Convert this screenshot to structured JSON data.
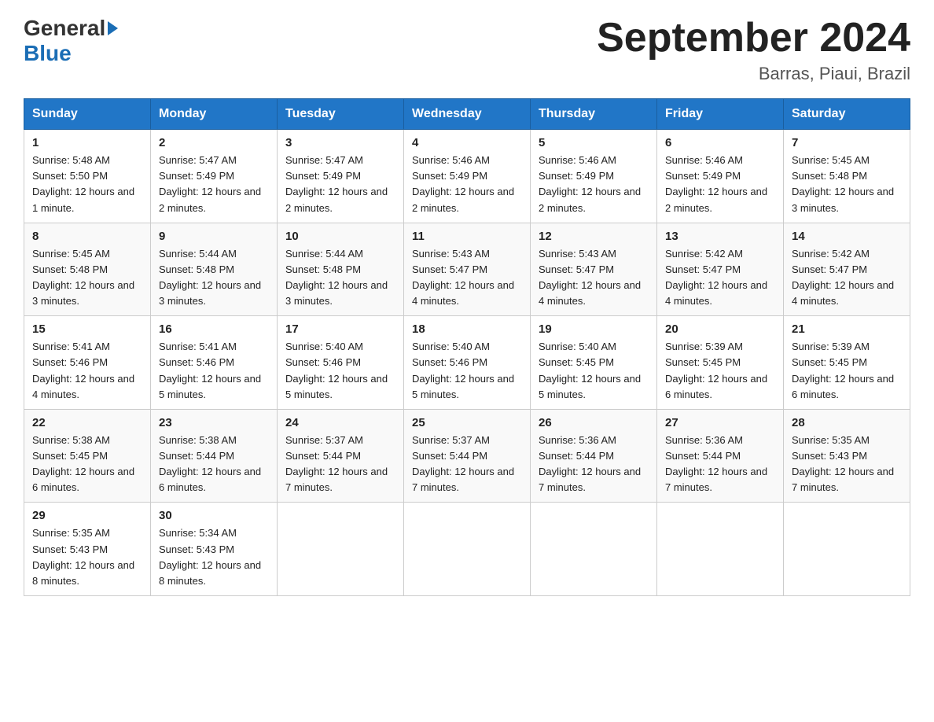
{
  "logo": {
    "text_general": "General",
    "text_blue": "Blue",
    "triangle_color": "#1a6db5"
  },
  "header": {
    "title": "September 2024",
    "subtitle": "Barras, Piaui, Brazil"
  },
  "columns": [
    "Sunday",
    "Monday",
    "Tuesday",
    "Wednesday",
    "Thursday",
    "Friday",
    "Saturday"
  ],
  "weeks": [
    [
      {
        "day": "1",
        "sunrise": "Sunrise: 5:48 AM",
        "sunset": "Sunset: 5:50 PM",
        "daylight": "Daylight: 12 hours and 1 minute."
      },
      {
        "day": "2",
        "sunrise": "Sunrise: 5:47 AM",
        "sunset": "Sunset: 5:49 PM",
        "daylight": "Daylight: 12 hours and 2 minutes."
      },
      {
        "day": "3",
        "sunrise": "Sunrise: 5:47 AM",
        "sunset": "Sunset: 5:49 PM",
        "daylight": "Daylight: 12 hours and 2 minutes."
      },
      {
        "day": "4",
        "sunrise": "Sunrise: 5:46 AM",
        "sunset": "Sunset: 5:49 PM",
        "daylight": "Daylight: 12 hours and 2 minutes."
      },
      {
        "day": "5",
        "sunrise": "Sunrise: 5:46 AM",
        "sunset": "Sunset: 5:49 PM",
        "daylight": "Daylight: 12 hours and 2 minutes."
      },
      {
        "day": "6",
        "sunrise": "Sunrise: 5:46 AM",
        "sunset": "Sunset: 5:49 PM",
        "daylight": "Daylight: 12 hours and 2 minutes."
      },
      {
        "day": "7",
        "sunrise": "Sunrise: 5:45 AM",
        "sunset": "Sunset: 5:48 PM",
        "daylight": "Daylight: 12 hours and 3 minutes."
      }
    ],
    [
      {
        "day": "8",
        "sunrise": "Sunrise: 5:45 AM",
        "sunset": "Sunset: 5:48 PM",
        "daylight": "Daylight: 12 hours and 3 minutes."
      },
      {
        "day": "9",
        "sunrise": "Sunrise: 5:44 AM",
        "sunset": "Sunset: 5:48 PM",
        "daylight": "Daylight: 12 hours and 3 minutes."
      },
      {
        "day": "10",
        "sunrise": "Sunrise: 5:44 AM",
        "sunset": "Sunset: 5:48 PM",
        "daylight": "Daylight: 12 hours and 3 minutes."
      },
      {
        "day": "11",
        "sunrise": "Sunrise: 5:43 AM",
        "sunset": "Sunset: 5:47 PM",
        "daylight": "Daylight: 12 hours and 4 minutes."
      },
      {
        "day": "12",
        "sunrise": "Sunrise: 5:43 AM",
        "sunset": "Sunset: 5:47 PM",
        "daylight": "Daylight: 12 hours and 4 minutes."
      },
      {
        "day": "13",
        "sunrise": "Sunrise: 5:42 AM",
        "sunset": "Sunset: 5:47 PM",
        "daylight": "Daylight: 12 hours and 4 minutes."
      },
      {
        "day": "14",
        "sunrise": "Sunrise: 5:42 AM",
        "sunset": "Sunset: 5:47 PM",
        "daylight": "Daylight: 12 hours and 4 minutes."
      }
    ],
    [
      {
        "day": "15",
        "sunrise": "Sunrise: 5:41 AM",
        "sunset": "Sunset: 5:46 PM",
        "daylight": "Daylight: 12 hours and 4 minutes."
      },
      {
        "day": "16",
        "sunrise": "Sunrise: 5:41 AM",
        "sunset": "Sunset: 5:46 PM",
        "daylight": "Daylight: 12 hours and 5 minutes."
      },
      {
        "day": "17",
        "sunrise": "Sunrise: 5:40 AM",
        "sunset": "Sunset: 5:46 PM",
        "daylight": "Daylight: 12 hours and 5 minutes."
      },
      {
        "day": "18",
        "sunrise": "Sunrise: 5:40 AM",
        "sunset": "Sunset: 5:46 PM",
        "daylight": "Daylight: 12 hours and 5 minutes."
      },
      {
        "day": "19",
        "sunrise": "Sunrise: 5:40 AM",
        "sunset": "Sunset: 5:45 PM",
        "daylight": "Daylight: 12 hours and 5 minutes."
      },
      {
        "day": "20",
        "sunrise": "Sunrise: 5:39 AM",
        "sunset": "Sunset: 5:45 PM",
        "daylight": "Daylight: 12 hours and 6 minutes."
      },
      {
        "day": "21",
        "sunrise": "Sunrise: 5:39 AM",
        "sunset": "Sunset: 5:45 PM",
        "daylight": "Daylight: 12 hours and 6 minutes."
      }
    ],
    [
      {
        "day": "22",
        "sunrise": "Sunrise: 5:38 AM",
        "sunset": "Sunset: 5:45 PM",
        "daylight": "Daylight: 12 hours and 6 minutes."
      },
      {
        "day": "23",
        "sunrise": "Sunrise: 5:38 AM",
        "sunset": "Sunset: 5:44 PM",
        "daylight": "Daylight: 12 hours and 6 minutes."
      },
      {
        "day": "24",
        "sunrise": "Sunrise: 5:37 AM",
        "sunset": "Sunset: 5:44 PM",
        "daylight": "Daylight: 12 hours and 7 minutes."
      },
      {
        "day": "25",
        "sunrise": "Sunrise: 5:37 AM",
        "sunset": "Sunset: 5:44 PM",
        "daylight": "Daylight: 12 hours and 7 minutes."
      },
      {
        "day": "26",
        "sunrise": "Sunrise: 5:36 AM",
        "sunset": "Sunset: 5:44 PM",
        "daylight": "Daylight: 12 hours and 7 minutes."
      },
      {
        "day": "27",
        "sunrise": "Sunrise: 5:36 AM",
        "sunset": "Sunset: 5:44 PM",
        "daylight": "Daylight: 12 hours and 7 minutes."
      },
      {
        "day": "28",
        "sunrise": "Sunrise: 5:35 AM",
        "sunset": "Sunset: 5:43 PM",
        "daylight": "Daylight: 12 hours and 7 minutes."
      }
    ],
    [
      {
        "day": "29",
        "sunrise": "Sunrise: 5:35 AM",
        "sunset": "Sunset: 5:43 PM",
        "daylight": "Daylight: 12 hours and 8 minutes."
      },
      {
        "day": "30",
        "sunrise": "Sunrise: 5:34 AM",
        "sunset": "Sunset: 5:43 PM",
        "daylight": "Daylight: 12 hours and 8 minutes."
      },
      null,
      null,
      null,
      null,
      null
    ]
  ]
}
